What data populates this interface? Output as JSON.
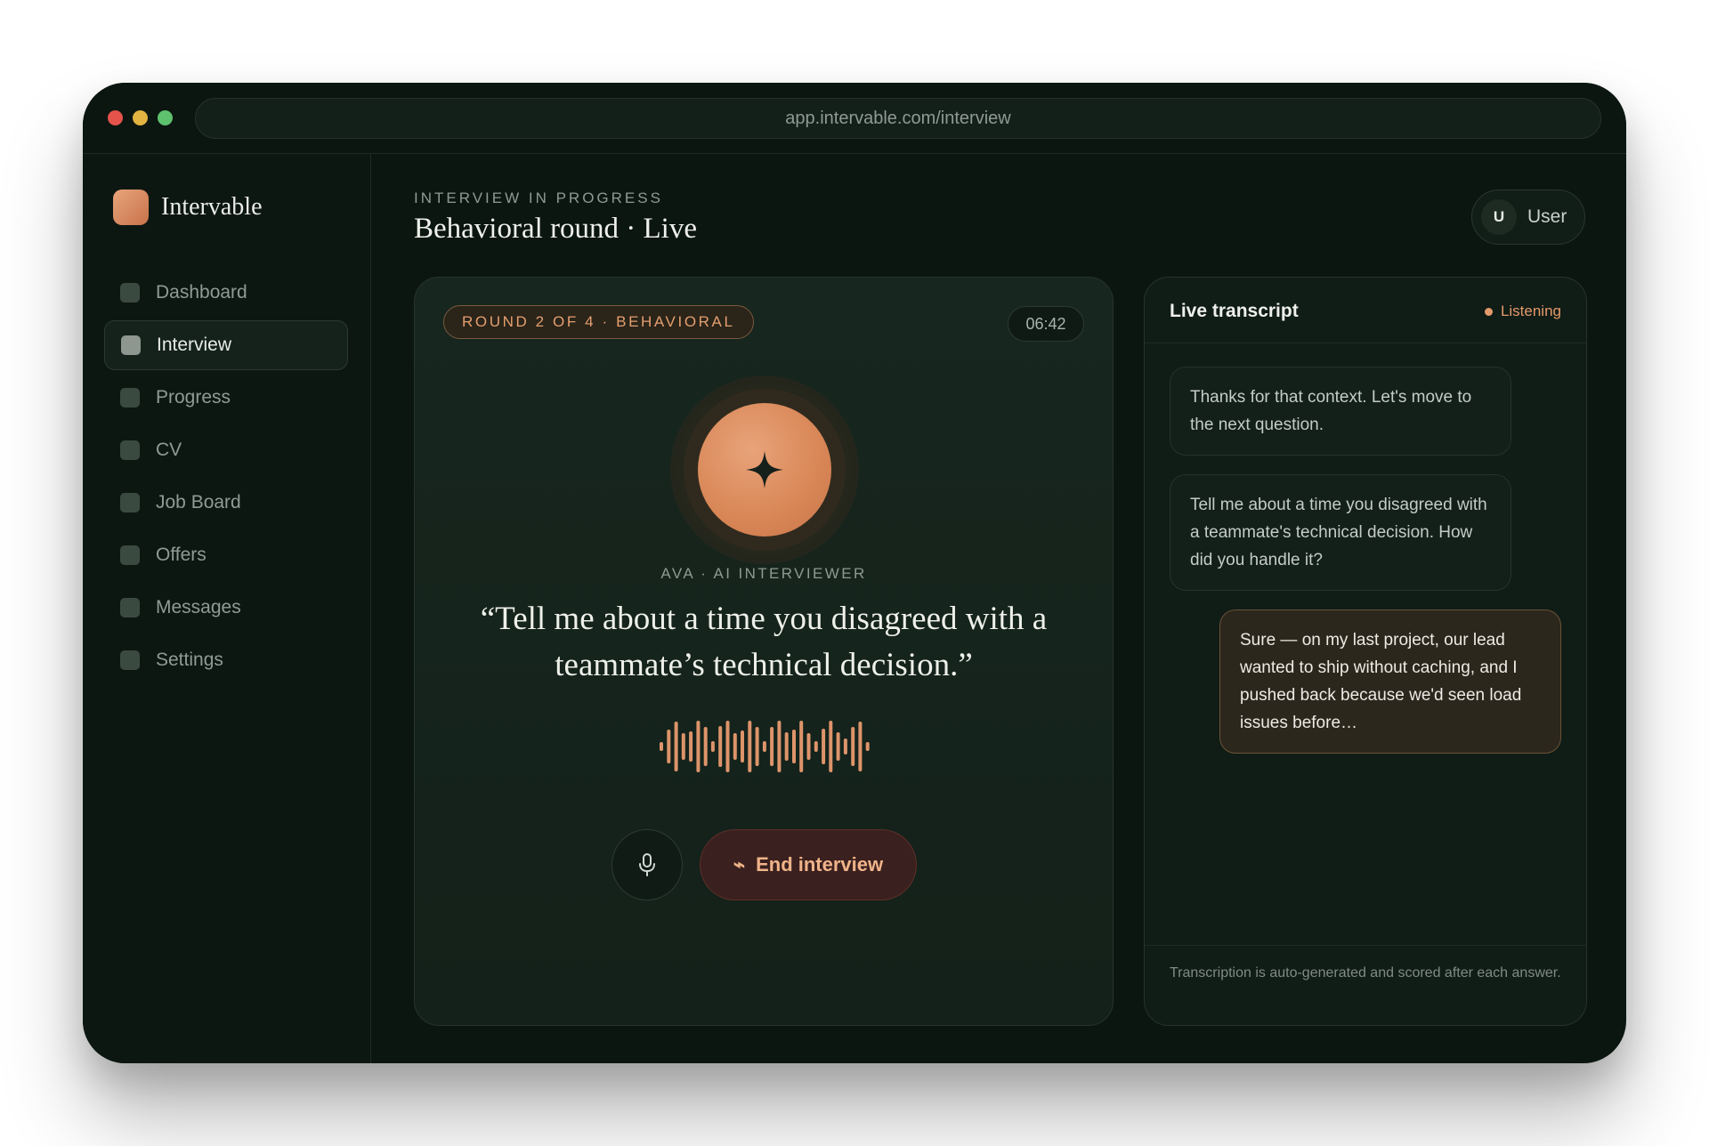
{
  "browser": {
    "url": "app.intervable.com/interview"
  },
  "brand": {
    "name": "Intervable"
  },
  "sidebar": {
    "items": [
      {
        "label": "Dashboard",
        "active": false
      },
      {
        "label": "Interview",
        "active": true
      },
      {
        "label": "Progress",
        "active": false
      },
      {
        "label": "CV",
        "active": false
      },
      {
        "label": "Job Board",
        "active": false
      },
      {
        "label": "Offers",
        "active": false
      },
      {
        "label": "Messages",
        "active": false
      },
      {
        "label": "Settings",
        "active": false
      }
    ]
  },
  "header": {
    "eyebrow": "INTERVIEW IN PROGRESS",
    "title": "Behavioral round · Live",
    "user": {
      "initial": "U",
      "name": "User"
    }
  },
  "stage": {
    "round_badge": "ROUND 2 OF 4 · BEHAVIORAL",
    "timer": "06:42",
    "speaker": "AVA · AI INTERVIEWER",
    "question": "“Tell me about a time you disagreed with a teammate’s technical decision.”",
    "end_button": "End interview",
    "icons": {
      "orb": "sparkle-icon",
      "mic": "microphone-icon",
      "end": "phone-hangup-icon"
    }
  },
  "transcript": {
    "title": "Live transcript",
    "status": "Listening",
    "messages": [
      {
        "role": "ai",
        "text": "Thanks for that context. Let's move to the next question."
      },
      {
        "role": "ai",
        "text": "Tell me about a time you disagreed with a teammate's technical decision. How did you handle it?"
      },
      {
        "role": "user",
        "text": "Sure — on my last project, our lead wanted to ship without caching, and I pushed back because we'd seen load issues before…"
      }
    ],
    "footer": "Transcription is auto-generated and scored after each answer."
  },
  "colors": {
    "accent": "#e39a6b",
    "background": "#0c1611",
    "end_button": "#3a201e"
  }
}
